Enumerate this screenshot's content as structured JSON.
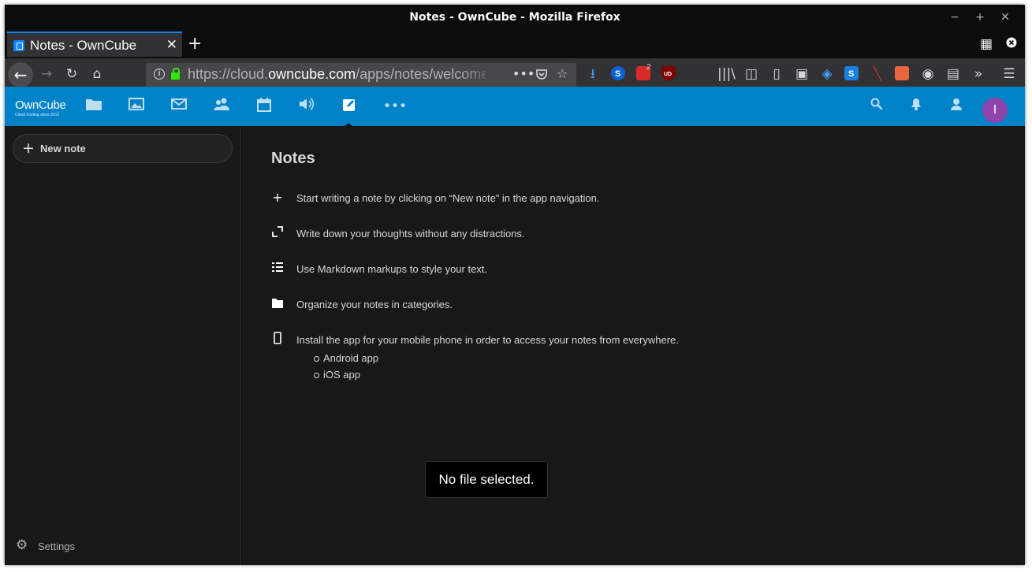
{
  "window": {
    "title": "Notes - OwnCube - Mozilla Firefox",
    "controls": {
      "minimize": "−",
      "maximize": "+",
      "close": "✕"
    }
  },
  "tabs": [
    {
      "title": "Notes - OwnCube",
      "close": "✕",
      "active": true
    }
  ],
  "tabstrip": {
    "new_tab": "+"
  },
  "navbar": {
    "url_prefix": "https://cloud.",
    "url_domain": "owncube.com",
    "url_path": "/apps/notes/welcome",
    "badge_count": "2",
    "icons": [
      "back-icon",
      "forward-icon",
      "reload-icon",
      "home-icon",
      "site-info-icon",
      "lock-icon",
      "page-actions-icon",
      "pocket-icon",
      "bookmark-star-icon",
      "download-icon",
      "library-icon",
      "sidebar-icon",
      "overflow-icon",
      "menu-icon"
    ]
  },
  "header": {
    "logo_name": "OwnCube",
    "logo_tagline": "Cloud hosting since 2012",
    "avatar_initial": "I",
    "apps": [
      "files",
      "photos",
      "mail",
      "contacts",
      "calendar",
      "audio",
      "notes",
      "more"
    ]
  },
  "sidebar": {
    "new_note_label": "New note",
    "settings_label": "Settings"
  },
  "main": {
    "title": "Notes",
    "features": [
      {
        "icon": "add-icon",
        "text": "Start writing a note by clicking on “New note” in the app navigation."
      },
      {
        "icon": "fullscreen-icon",
        "text": "Write down your thoughts without any distractions."
      },
      {
        "icon": "list-icon",
        "text": "Use Markdown markups to style your text."
      },
      {
        "icon": "folder-icon",
        "text": "Organize your notes in categories."
      },
      {
        "icon": "phone-icon",
        "text": "Install the app for your mobile phone in order to access your notes from everywhere."
      }
    ],
    "apps": [
      "Android app",
      "iOS app"
    ]
  },
  "toast": {
    "message": "No file selected."
  },
  "colors": {
    "header": "#0082c9",
    "background": "#181818",
    "avatar": "#8e44ad",
    "browser_chrome": "#323234"
  }
}
